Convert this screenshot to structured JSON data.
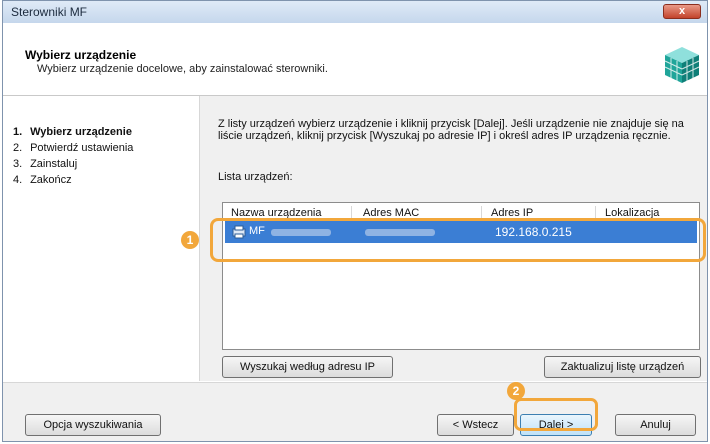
{
  "window": {
    "title": "Sterowniki MF",
    "close_label": "x"
  },
  "header": {
    "title": "Wybierz urządzenie",
    "subtitle": "Wybierz urządzenie docelowe, aby zainstalować sterowniki."
  },
  "steps": [
    {
      "num": "1.",
      "label": "Wybierz urządzenie",
      "active": true
    },
    {
      "num": "2.",
      "label": "Potwierdź ustawienia",
      "active": false
    },
    {
      "num": "3.",
      "label": "Zainstaluj",
      "active": false
    },
    {
      "num": "4.",
      "label": "Zakończ",
      "active": false
    }
  ],
  "content": {
    "instruction": "Z listy urządzeń wybierz urządzenie i kliknij przycisk [Dalej]. Jeśli urządzenie nie znajduje się na liście urządzeń, kliknij przycisk [Wyszukaj po adresie IP] i określ adres IP urządzenia ręcznie.",
    "list_label": "Lista urządzeń:",
    "columns": [
      "Nazwa urządzenia",
      "Adres MAC",
      "Adres IP",
      "Lokalizacja"
    ],
    "device": {
      "name": "MF",
      "ip": "192.168.0.215"
    }
  },
  "buttons": {
    "search_ip": "Wyszukaj według adresu IP",
    "refresh": "Zaktualizuj listę urządzeń",
    "search_options": "Opcja wyszukiwania",
    "back": "< Wstecz",
    "next": "Dalej >",
    "cancel": "Anuluj"
  },
  "callouts": {
    "first": "1",
    "second": "2"
  },
  "colors": {
    "highlight": "#f2a73b",
    "selection": "#3b7ed4"
  }
}
